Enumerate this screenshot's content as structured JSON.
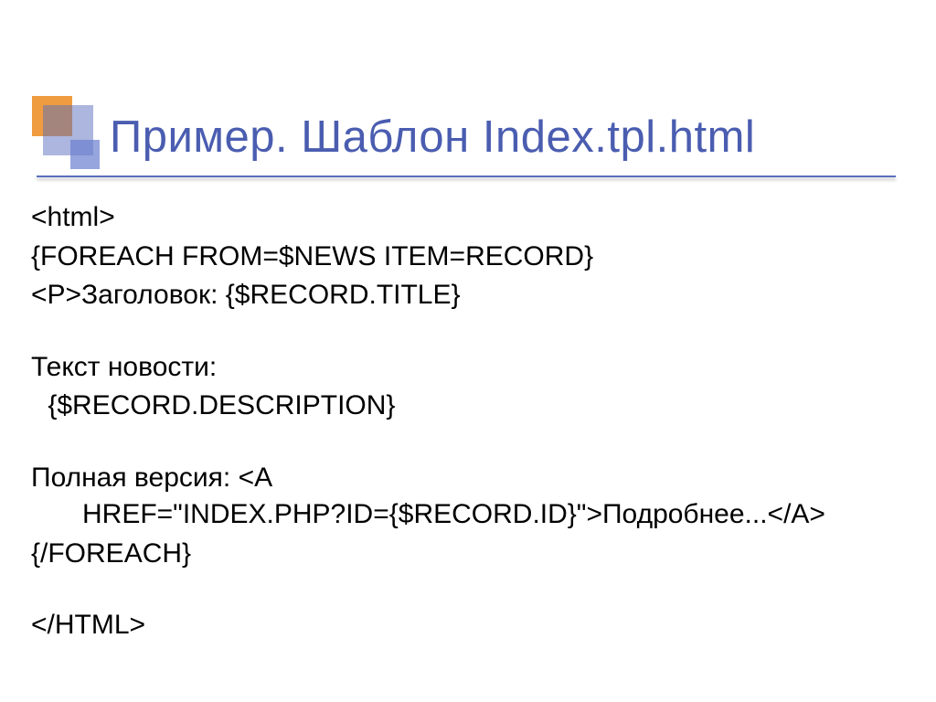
{
  "title": "Пример. Шаблон Index.tpl.html",
  "lines": {
    "l1": "<html>",
    "l2": "{FOREACH FROM=$NEWS ITEM=RECORD}",
    "l3": "<P>Заголовок: {$RECORD.TITLE}",
    "l4": "Текст новости:",
    "l5": " {$RECORD.DESCRIPTION}",
    "l6": "Полная версия: <A",
    "l7": "HREF=\"INDEX.PHP?ID={$RECORD.ID}\">Подробнее...</A>",
    "l8": "{/FOREACH}",
    "l9": "</HTML>"
  }
}
